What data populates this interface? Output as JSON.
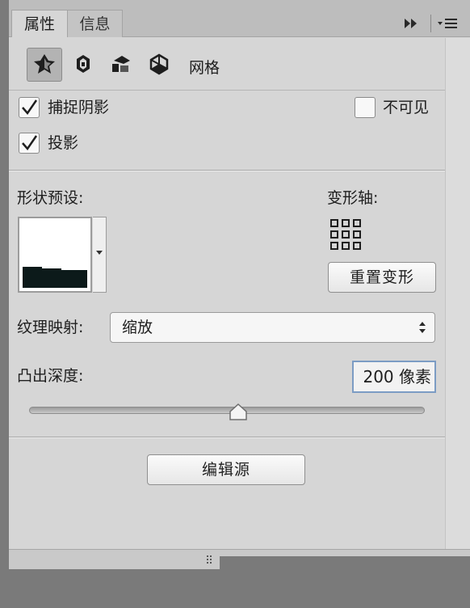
{
  "tabs": [
    {
      "label": "属性",
      "active": true
    },
    {
      "label": "信息",
      "active": false
    }
  ],
  "panel_icons": {
    "collapse": "double-chevron-right-icon",
    "menu": "panel-menu-icon"
  },
  "toolbar": {
    "tools": [
      "mesh-tool-icon",
      "deform-tool-icon",
      "cap-tool-icon",
      "coordinates-tool-icon"
    ],
    "mesh_label": "网格"
  },
  "options": {
    "catch_shadow": {
      "label": "捕捉阴影",
      "checked": true
    },
    "invisible": {
      "label": "不可见",
      "checked": false
    },
    "cast_shadow": {
      "label": "投影",
      "checked": true
    }
  },
  "shape_preset": {
    "label": "形状预设:"
  },
  "deform_axis": {
    "label": "变形轴:",
    "reset_label": "重置变形"
  },
  "texture_mapping": {
    "label": "纹理映射:",
    "value": "缩放"
  },
  "extrusion_depth": {
    "label": "凸出深度:",
    "value": "200 像素",
    "slider_fraction": 0.53
  },
  "edit_source": {
    "label": "编辑源"
  },
  "colors": {
    "panel_bg": "#d6d6d6",
    "preset_fill": "#0c1a1a",
    "focus_ring": "#7c9cc4"
  }
}
